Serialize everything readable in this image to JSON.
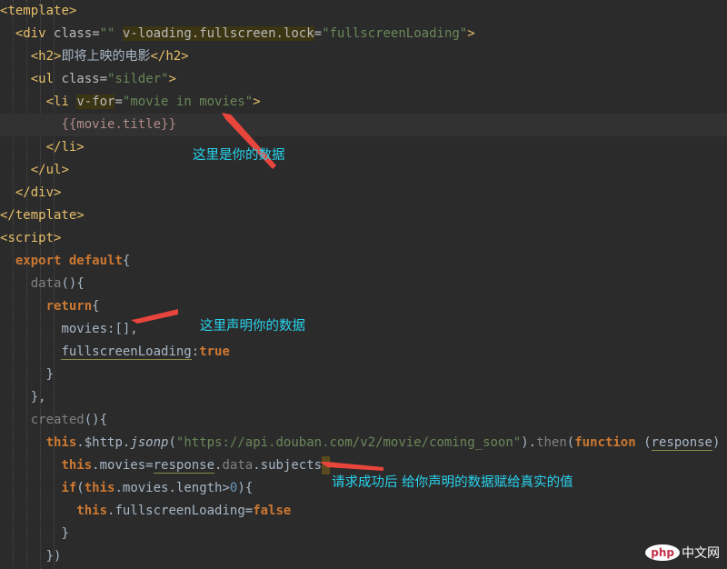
{
  "code": {
    "tag_template": "template",
    "tag_div": "div",
    "attr_class": "class",
    "div_class_val": "\"\"",
    "directive_loading": "v-loading.fullscreen.lock",
    "loading_val": "\"fullscreenLoading\"",
    "tag_h2": "h2",
    "h2_text": "即将上映的电影",
    "tag_ul": "ul",
    "ul_class_val": "\"silder\"",
    "tag_li": "li",
    "directive_for": "v-for",
    "for_val": "\"movie in movies\"",
    "mustache": "{{movie.title}}",
    "tag_script": "script",
    "kw_export": "export",
    "kw_default": "default",
    "fn_data": "data",
    "kw_return": "return",
    "prop_movies": "movies",
    "empty_array": ":[],",
    "prop_fsl": "fullscreenLoading",
    "colon": ":",
    "kw_true": "true",
    "comma_brace": "},",
    "fn_created": "created",
    "kw_this": "this",
    "http": "$http",
    "jsonp": "jsonp",
    "url": "\"https://api.douban.com/v2/movie/coming_soon\"",
    "then": "then",
    "kw_function": "function",
    "param_response": "response",
    "prop_data": "data",
    "prop_subjects": "subjects",
    "kw_if": "if",
    "prop_length": "length",
    "num_zero": "0",
    "kw_false": "false",
    "close_paren": "})"
  },
  "annotations": {
    "note1": "这里是你的数据",
    "note2": "这里声明你的数据",
    "note3": "请求成功后 给你声明的数据赋给真实的值"
  },
  "watermark": {
    "badge": "php",
    "text": "中文网"
  },
  "colors": {
    "background": "#2b2b2b",
    "annotation": "#28d3ee",
    "arrow": "#e8453c",
    "tag": "#e8bf6a",
    "string": "#6a8759",
    "keyword": "#cc7832"
  }
}
